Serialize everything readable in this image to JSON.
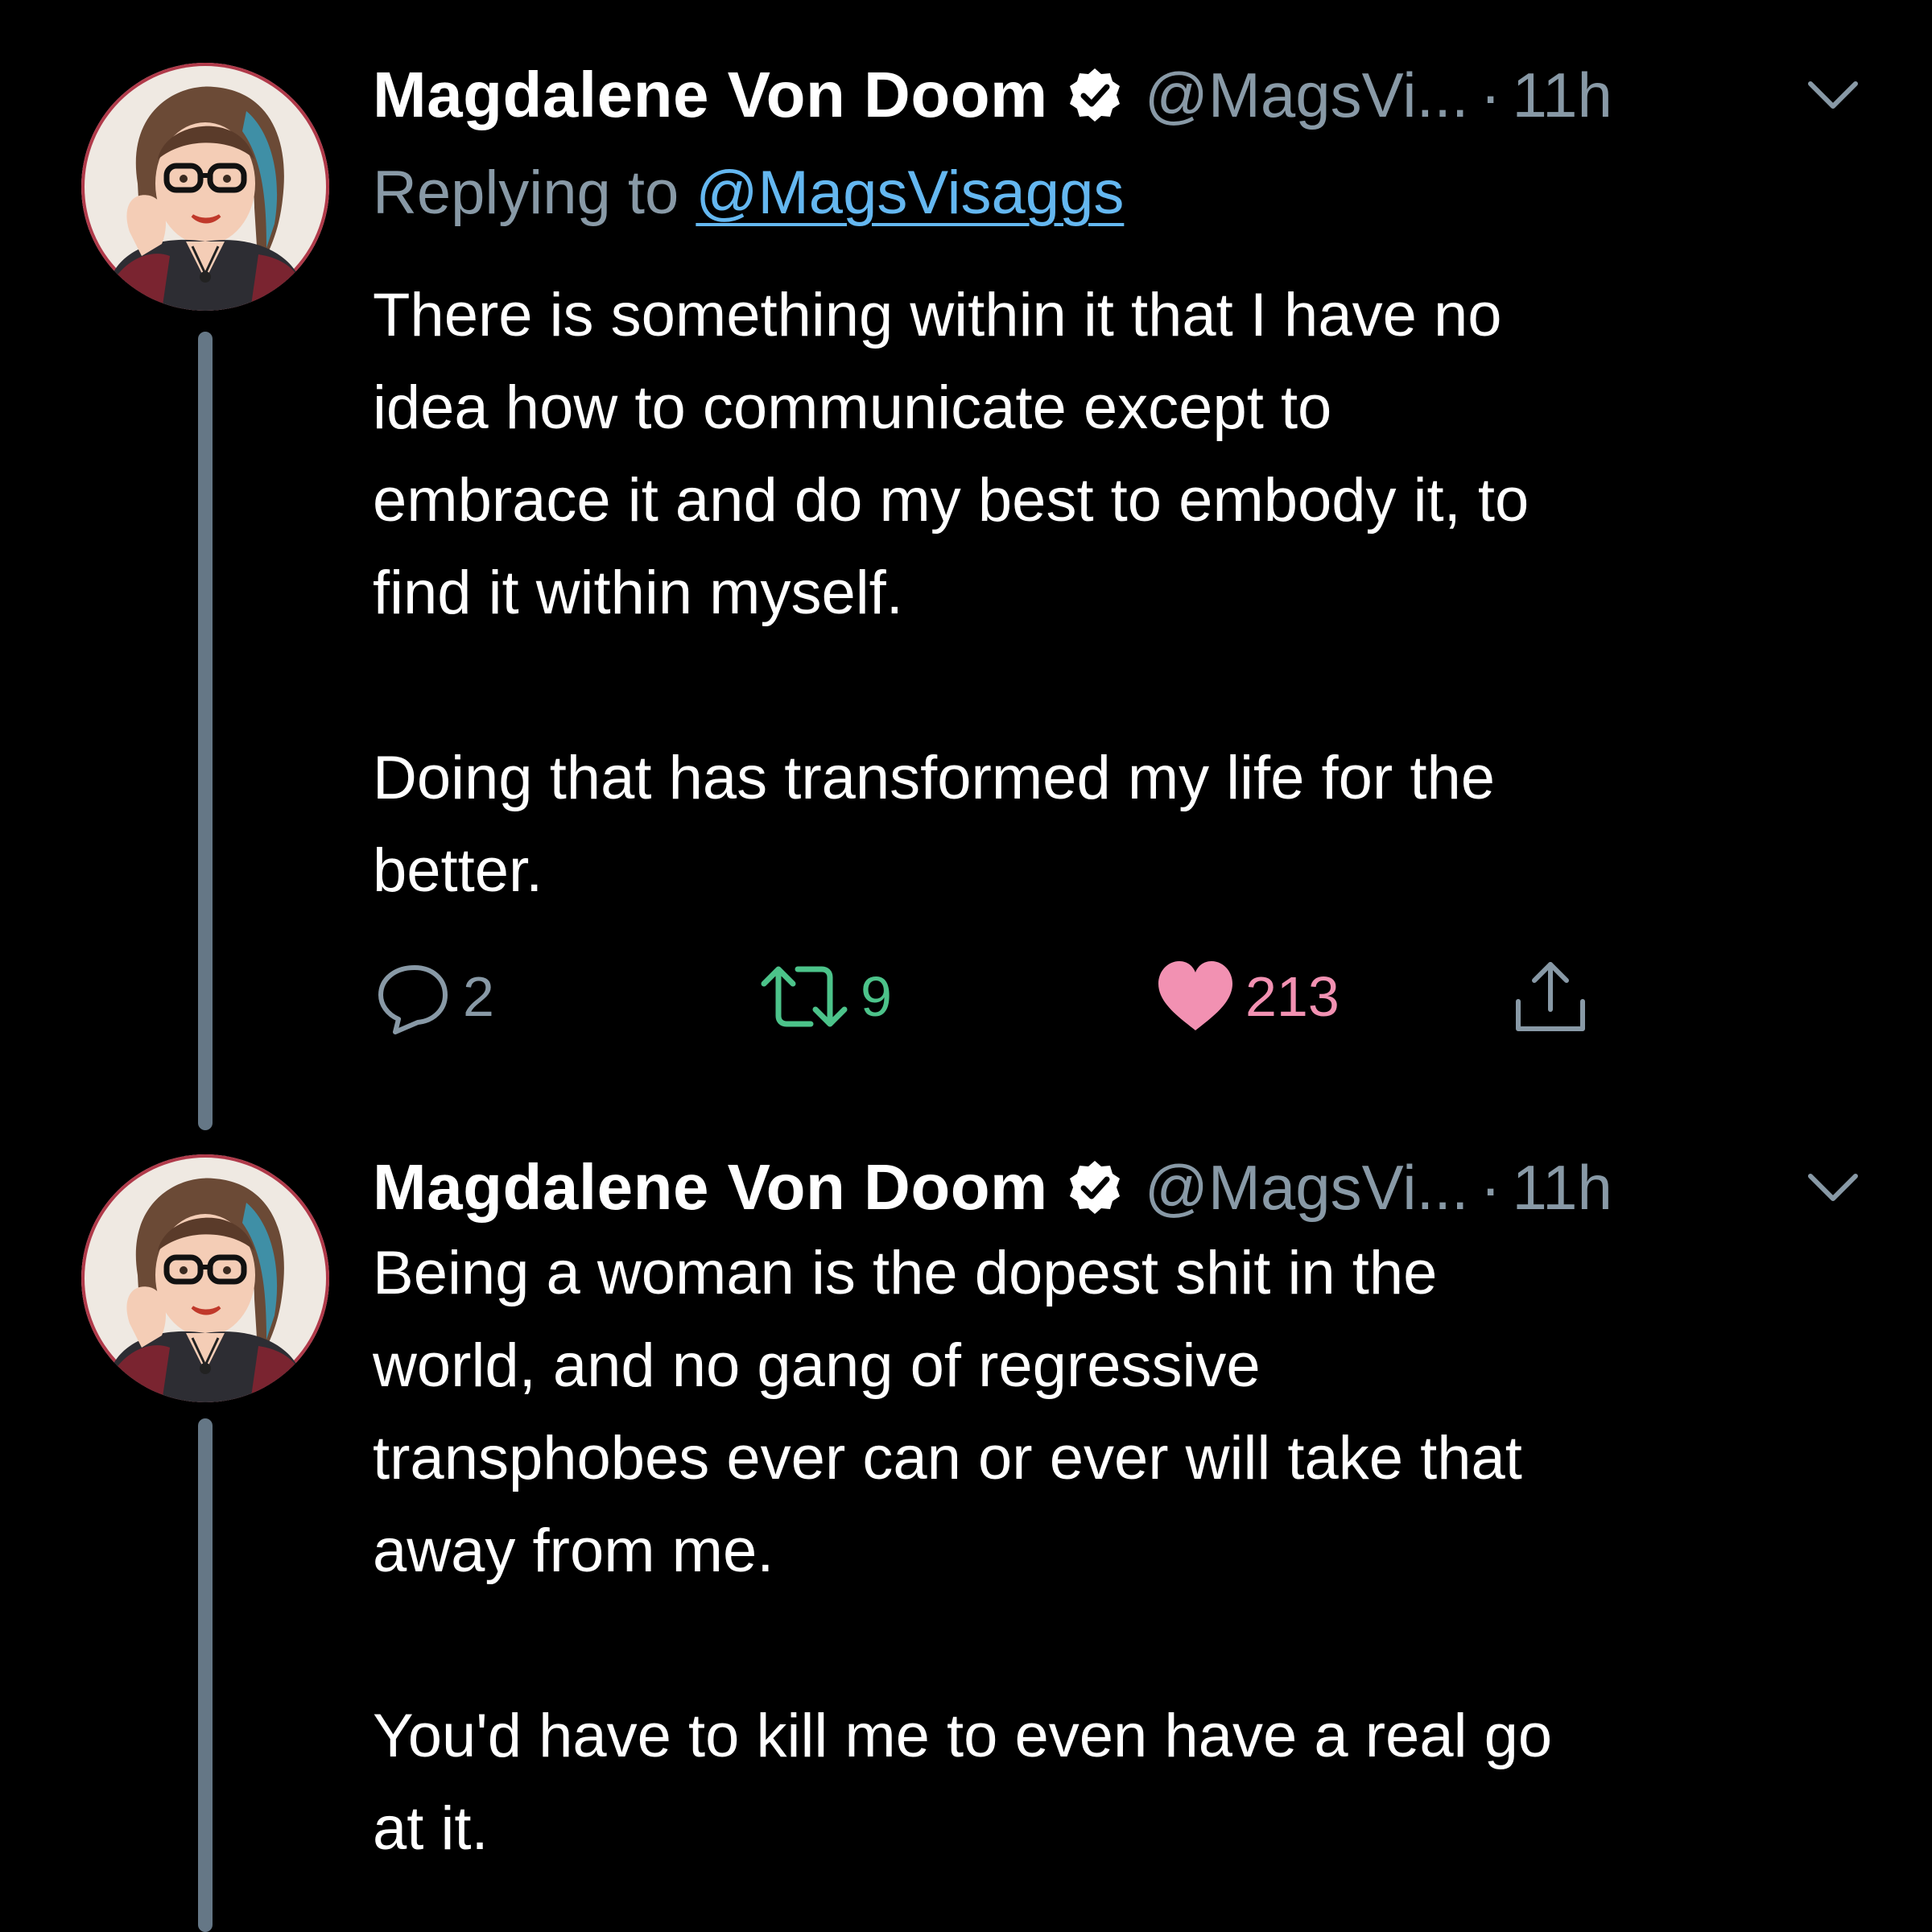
{
  "colors": {
    "background": "#000000",
    "text": "#ffffff",
    "muted": "#8899a6",
    "link": "#64b7f0",
    "retweet": "#4cc38a",
    "like": "#f291b2",
    "thread_line": "#657786"
  },
  "tweets": [
    {
      "author_name": "Magdalene Von Doom",
      "handle": "@MagsVi...",
      "separator": "·",
      "time": "11h",
      "verified_icon": "verified-badge-icon",
      "menu_icon": "chevron-down-icon",
      "replying_prefix": "Replying to ",
      "replying_handle": "@MagsVisaggs",
      "lines": [
        "There is something within it that I have no",
        "idea how to communicate except to",
        "embrace it and do my best to embody it, to",
        "find it within myself.",
        "Doing that has transformed my life for the",
        "better."
      ],
      "actions": {
        "reply_count": "2",
        "retweet_count": "9",
        "like_count": "213",
        "reply_icon": "reply-bubble-icon",
        "retweet_icon": "retweet-icon",
        "like_icon": "heart-icon",
        "share_icon": "share-icon"
      }
    },
    {
      "author_name": "Magdalene Von Doom",
      "handle": "@MagsVi...",
      "separator": "·",
      "time": "11h",
      "verified_icon": "verified-badge-icon",
      "menu_icon": "chevron-down-icon",
      "lines": [
        "Being a woman is the dopest shit in the",
        "world, and no gang of regressive",
        "transphobes ever can or ever will take that",
        "away from me.",
        "You'd have to kill me to even have a real go",
        "at it."
      ]
    }
  ]
}
